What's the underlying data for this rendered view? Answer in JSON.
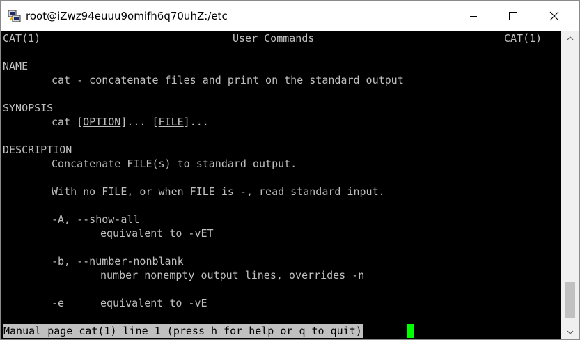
{
  "window": {
    "title": "root@iZwz94euuu9omifh6q70uhZ:/etc",
    "icon": "putty-icon"
  },
  "controls": {
    "minimize": "minimize-icon",
    "maximize": "maximize-icon",
    "close": "close-icon"
  },
  "terminal": {
    "header_left": "CAT(1)",
    "header_center": "User Commands",
    "header_right": "CAT(1)",
    "name_heading": "NAME",
    "name_desc": "cat - concatenate files and print on the standard output",
    "synopsis_heading": "SYNOPSIS",
    "synopsis_cmd": "cat",
    "synopsis_option": "OPTION",
    "synopsis_ellipsis": "...",
    "synopsis_file": "FILE",
    "description_heading": "DESCRIPTION",
    "description_line1": "Concatenate FILE(s) to standard output.",
    "description_line2": "With no FILE, or when FILE is -, read standard input.",
    "opt_a": "-A, --show-all",
    "opt_a_desc": "equivalent to -vET",
    "opt_b": "-b, --number-nonblank",
    "opt_b_desc": "number nonempty output lines, overrides -n",
    "opt_e": "-e",
    "opt_e_desc": "equivalent to -vE",
    "status": "Manual page cat(1) line 1 (press h for help or q to quit)"
  },
  "colors": {
    "terminal_bg": "#000000",
    "terminal_fg": "#c0c0c0",
    "status_bg": "#c0c0c0",
    "cursor": "#00ff00"
  }
}
